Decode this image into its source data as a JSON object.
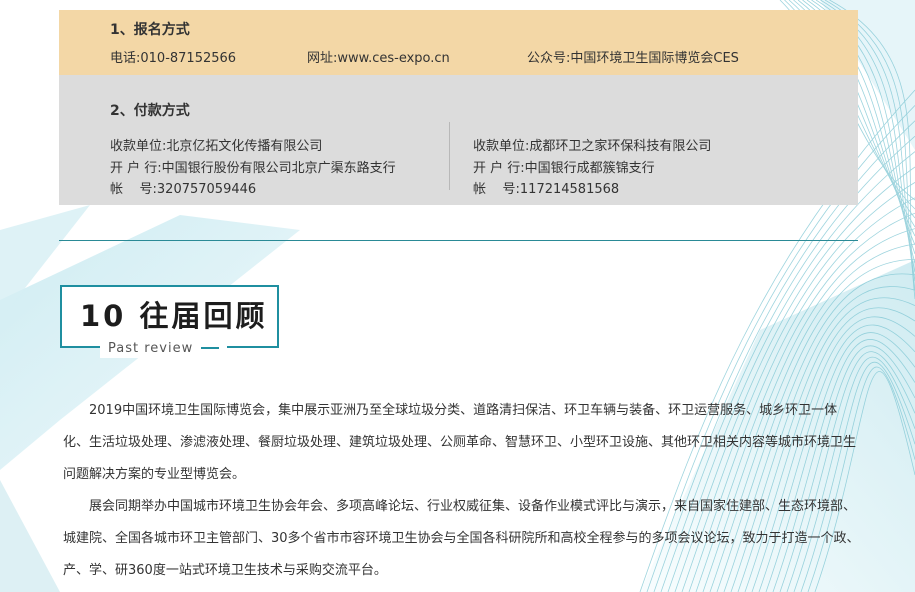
{
  "registration": {
    "heading": "1、报名方式",
    "phone": "电话:010-87152566",
    "website": "网址:www.ces-expo.cn",
    "wechat": "公众号:中国环境卫生国际博览会CES"
  },
  "payment": {
    "heading": "2、付款方式",
    "left": {
      "payee": "收款单位:北京亿拓文化传播有限公司",
      "bank": "开 户 行:中国银行股份有限公司北京广渠东路支行",
      "account": "帐    号:320757059446"
    },
    "right": {
      "payee": "收款单位:成都环卫之家环保科技有限公司",
      "bank": "开 户 行:中国银行成都簇锦支行",
      "account": "帐    号:117214581568"
    }
  },
  "section": {
    "title": "10 往届回顾",
    "subtitle": "Past review"
  },
  "paragraphs": [
    "2019中国环境卫生国际博览会，集中展示亚洲乃至全球垃圾分类、道路清扫保洁、环卫车辆与装备、环卫运营服务、城乡环卫一体化、生活垃圾处理、渗滤液处理、餐厨垃圾处理、建筑垃圾处理、公厕革命、智慧环卫、小型环卫设施、其他环卫相关内容等城市环境卫生问题解决方案的专业型博览会。",
    "展会同期举办中国城市环境卫生协会年会、多项高峰论坛、行业权威征集、设备作业模式评比与演示，来自国家住建部、生态环境部、城建院、全国各城市环卫主管部门、30多个省市市容环境卫生协会与全国各科研院所和高校全程参与的多项会议论坛，致力于打造一个政、产、学、研360度一站式环境卫生技术与采购交流平台。"
  ],
  "colors": {
    "reg_bg": "#f3d7a6",
    "pay_bg": "#dcdcdc",
    "accent": "#1f8fa0"
  }
}
